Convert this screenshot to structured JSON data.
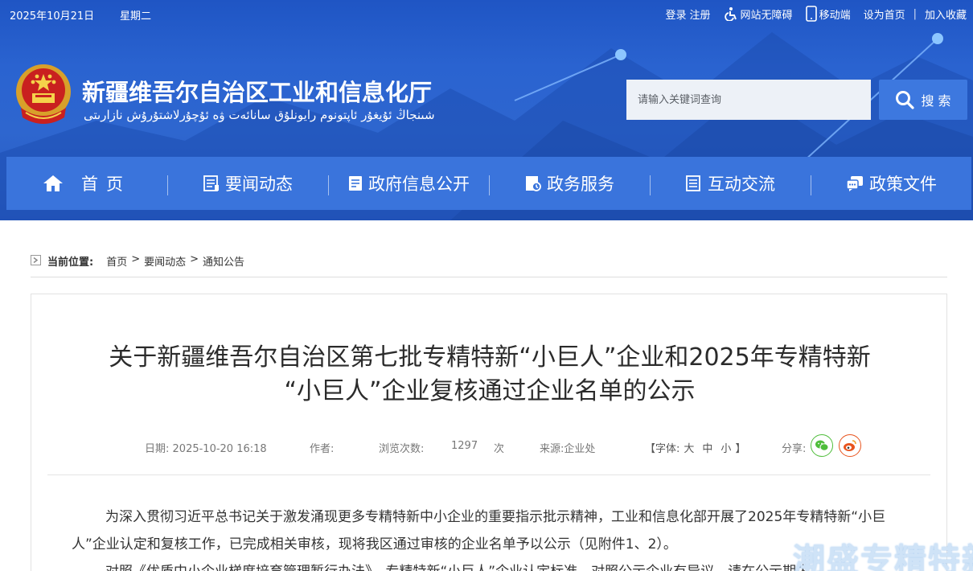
{
  "topbar": {
    "date": "2025年10月21日",
    "weekday": "星期二",
    "login": "登录",
    "register": "注册",
    "accessibility": "网站无障碍",
    "mobile": "移动端",
    "set_home": "设为首页",
    "separator": "|",
    "favorite": "加入收藏"
  },
  "header": {
    "site_title": "新疆维吾尔自治区工业和信息化厅",
    "site_subtitle": "شىنجاڭ ئۇيغۇر ئاپتونوم رايونلۇق سانائەت ۋە ئۇچۇرلاشتۇرۇش نازارىتى"
  },
  "search": {
    "placeholder": "请输入关键词查询",
    "button_label": "搜 索"
  },
  "nav": {
    "items": [
      {
        "label": "首页",
        "icon": "home-icon"
      },
      {
        "label": "要闻动态",
        "icon": "news-icon"
      },
      {
        "label": "政府信息公开",
        "icon": "info-book-icon"
      },
      {
        "label": "政务服务",
        "icon": "service-icon"
      },
      {
        "label": "互动交流",
        "icon": "interact-icon"
      },
      {
        "label": "政策文件",
        "icon": "chat-docs-icon"
      }
    ]
  },
  "breadcrumb": {
    "label": "当前位置:",
    "items": [
      "首页",
      "要闻动态",
      "通知公告"
    ],
    "separator": ">"
  },
  "article": {
    "title_line1": "关于新疆维吾尔自治区第七批专精特新“小巨人”企业和2025年专精特新",
    "title_line2": "“小巨人”企业复核通过企业名单的公示",
    "meta": {
      "date_label": "日期:",
      "date_value": "2025-10-20 16:18",
      "author_label": "作者:",
      "views_label": "浏览次数:",
      "views_value": "1297",
      "views_unit": "次",
      "source_label": "来源:",
      "source_value": "企业处",
      "font_open": "【字体:",
      "font_large": "大",
      "font_medium": "中",
      "font_small": "小",
      "font_close": "】",
      "share_label": "分享:"
    },
    "paragraph1": "为深入贯彻习近平总书记关于激发涌现更多专精特新中小企业的重要指示批示精神，工业和信息化部开展了2025年专精特新“小巨人”企业认定和复核工作，已完成相关审核，现将我区通过审核的企业名单予以公示（见附件1、2）。",
    "paragraph2": "对照《优质中小企业梯度培育管理暂行办法》，专精特新“小巨人”企业认定标准，对照公示企业有异议，请在公示期内"
  },
  "watermark": "潮盛专精特新",
  "colors": {
    "banner": "#2a63d0",
    "nav": "#3a74dc",
    "search_button": "#3d78df",
    "wechat": "#4ebd3a",
    "weibo": "#e8541e"
  }
}
